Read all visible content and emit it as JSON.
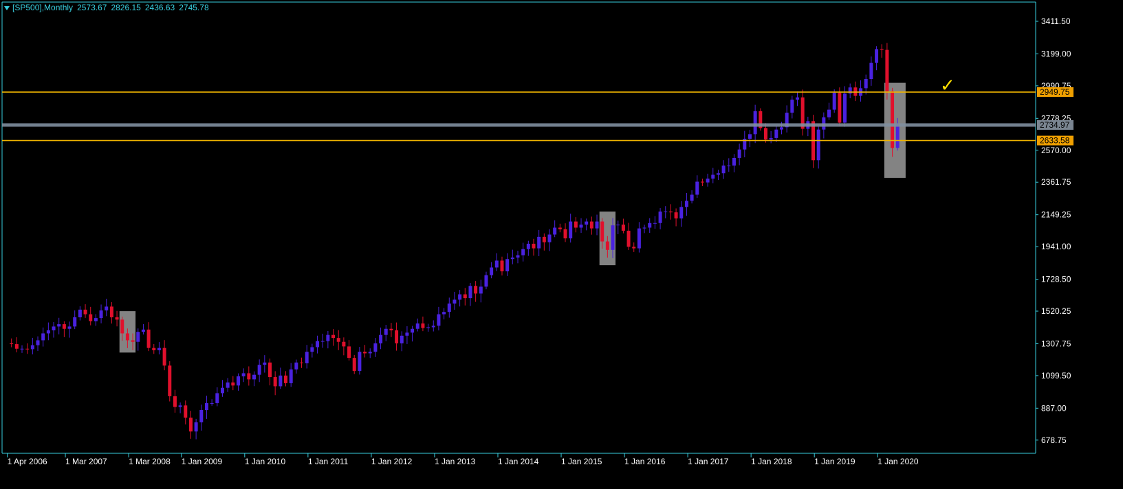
{
  "header": {
    "symbol": "[SP500],Monthly",
    "open": "2573.67",
    "high": "2826.15",
    "low": "2436.63",
    "close": "2745.78"
  },
  "colors": {
    "background": "#000000",
    "axis": "#39d0e0",
    "bull_candle": "#4a22e0",
    "bear_candle": "#e0102c",
    "level_line": "#f0b400",
    "price_line": "#8090a0",
    "zone": "#9a9a9a",
    "check": "#ffe000"
  },
  "icons": {
    "checkmark": "✓"
  },
  "chart_data": {
    "type": "candlestick",
    "timeframe": "Monthly",
    "ylim": [
      620,
      3480
    ],
    "y_ticks": [
      "3411.50",
      "3199.00",
      "2990.75",
      "2778.25",
      "2570.00",
      "2361.75",
      "2149.25",
      "1941.00",
      "1728.50",
      "1520.25",
      "1307.75",
      "1099.50",
      "887.00",
      "678.75"
    ],
    "x_tick_labels": [
      "1 Apr 2006",
      "1 Mar 2007",
      "1 Mar 2008",
      "1 Jan 2009",
      "1 Jan 2010",
      "1 Jan 2011",
      "1 Jan 2012",
      "1 Jan 2013",
      "1 Jan 2014",
      "1 Jan 2015",
      "1 Jan 2016",
      "1 Jan 2017",
      "1 Jan 2018",
      "1 Jan 2019",
      "1 Jan 2020"
    ],
    "levels": [
      {
        "label": "2949.75",
        "value": 2949.75,
        "kind": "resistance"
      },
      {
        "label": "2734.97",
        "value": 2734.97,
        "kind": "current"
      },
      {
        "label": "2633.58",
        "value": 2633.58,
        "kind": "support"
      }
    ],
    "zones": [
      {
        "from": "2008-01",
        "to": "2008-03",
        "low": 1250,
        "high": 1520
      },
      {
        "from": "2015-08",
        "to": "2015-10",
        "low": 1820,
        "high": 2170
      },
      {
        "from": "2020-02",
        "to": "2020-05",
        "low": 2390,
        "high": 3010
      }
    ],
    "close_series": [
      [
        "2006-03",
        1310
      ],
      [
        "2006-04",
        1305
      ],
      [
        "2006-05",
        1275
      ],
      [
        "2006-06",
        1275
      ],
      [
        "2006-07",
        1272
      ],
      [
        "2006-08",
        1298
      ],
      [
        "2006-09",
        1330
      ],
      [
        "2006-10",
        1375
      ],
      [
        "2006-11",
        1395
      ],
      [
        "2006-12",
        1420
      ],
      [
        "2007-01",
        1435
      ],
      [
        "2007-02",
        1405
      ],
      [
        "2007-03",
        1420
      ],
      [
        "2007-04",
        1480
      ],
      [
        "2007-05",
        1530
      ],
      [
        "2007-06",
        1500
      ],
      [
        "2007-07",
        1455
      ],
      [
        "2007-08",
        1475
      ],
      [
        "2007-09",
        1525
      ],
      [
        "2007-10",
        1550
      ],
      [
        "2007-11",
        1480
      ],
      [
        "2007-12",
        1465
      ],
      [
        "2008-01",
        1375
      ],
      [
        "2008-02",
        1330
      ],
      [
        "2008-03",
        1320
      ],
      [
        "2008-04",
        1385
      ],
      [
        "2008-05",
        1400
      ],
      [
        "2008-06",
        1280
      ],
      [
        "2008-07",
        1265
      ],
      [
        "2008-08",
        1280
      ],
      [
        "2008-09",
        1165
      ],
      [
        "2008-10",
        965
      ],
      [
        "2008-11",
        895
      ],
      [
        "2008-12",
        905
      ],
      [
        "2009-01",
        825
      ],
      [
        "2009-02",
        735
      ],
      [
        "2009-03",
        795
      ],
      [
        "2009-04",
        875
      ],
      [
        "2009-05",
        920
      ],
      [
        "2009-06",
        920
      ],
      [
        "2009-07",
        985
      ],
      [
        "2009-08",
        1020
      ],
      [
        "2009-09",
        1055
      ],
      [
        "2009-10",
        1035
      ],
      [
        "2009-11",
        1095
      ],
      [
        "2009-12",
        1115
      ],
      [
        "2010-01",
        1075
      ],
      [
        "2010-02",
        1105
      ],
      [
        "2010-03",
        1170
      ],
      [
        "2010-04",
        1185
      ],
      [
        "2010-05",
        1090
      ],
      [
        "2010-06",
        1030
      ],
      [
        "2010-07",
        1100
      ],
      [
        "2010-08",
        1050
      ],
      [
        "2010-09",
        1140
      ],
      [
        "2010-10",
        1185
      ],
      [
        "2010-11",
        1180
      ],
      [
        "2010-12",
        1255
      ],
      [
        "2011-01",
        1285
      ],
      [
        "2011-02",
        1325
      ],
      [
        "2011-03",
        1325
      ],
      [
        "2011-04",
        1365
      ],
      [
        "2011-05",
        1345
      ],
      [
        "2011-06",
        1320
      ],
      [
        "2011-07",
        1290
      ],
      [
        "2011-08",
        1215
      ],
      [
        "2011-09",
        1130
      ],
      [
        "2011-10",
        1255
      ],
      [
        "2011-11",
        1245
      ],
      [
        "2011-12",
        1255
      ],
      [
        "2012-01",
        1310
      ],
      [
        "2012-02",
        1365
      ],
      [
        "2012-03",
        1405
      ],
      [
        "2012-04",
        1395
      ],
      [
        "2012-05",
        1310
      ],
      [
        "2012-06",
        1360
      ],
      [
        "2012-07",
        1380
      ],
      [
        "2012-08",
        1405
      ],
      [
        "2012-09",
        1440
      ],
      [
        "2012-10",
        1410
      ],
      [
        "2012-11",
        1415
      ],
      [
        "2012-12",
        1425
      ],
      [
        "2013-01",
        1500
      ],
      [
        "2013-02",
        1515
      ],
      [
        "2013-03",
        1570
      ],
      [
        "2013-04",
        1595
      ],
      [
        "2013-05",
        1630
      ],
      [
        "2013-06",
        1605
      ],
      [
        "2013-07",
        1685
      ],
      [
        "2013-08",
        1635
      ],
      [
        "2013-09",
        1680
      ],
      [
        "2013-10",
        1755
      ],
      [
        "2013-11",
        1805
      ],
      [
        "2013-12",
        1850
      ],
      [
        "2014-01",
        1780
      ],
      [
        "2014-02",
        1860
      ],
      [
        "2014-03",
        1870
      ],
      [
        "2014-04",
        1885
      ],
      [
        "2014-05",
        1925
      ],
      [
        "2014-06",
        1960
      ],
      [
        "2014-07",
        1930
      ],
      [
        "2014-08",
        2005
      ],
      [
        "2014-09",
        1970
      ],
      [
        "2014-10",
        2020
      ],
      [
        "2014-11",
        2065
      ],
      [
        "2014-12",
        2055
      ],
      [
        "2015-01",
        1995
      ],
      [
        "2015-02",
        2105
      ],
      [
        "2015-03",
        2065
      ],
      [
        "2015-04",
        2085
      ],
      [
        "2015-05",
        2105
      ],
      [
        "2015-06",
        2060
      ],
      [
        "2015-07",
        2105
      ],
      [
        "2015-08",
        1975
      ],
      [
        "2015-09",
        1920
      ],
      [
        "2015-10",
        2080
      ],
      [
        "2015-11",
        2085
      ],
      [
        "2015-12",
        2045
      ],
      [
        "2016-01",
        1940
      ],
      [
        "2016-02",
        1930
      ],
      [
        "2016-03",
        2060
      ],
      [
        "2016-04",
        2065
      ],
      [
        "2016-05",
        2095
      ],
      [
        "2016-06",
        2095
      ],
      [
        "2016-07",
        2170
      ],
      [
        "2016-08",
        2170
      ],
      [
        "2016-09",
        2165
      ],
      [
        "2016-10",
        2125
      ],
      [
        "2016-11",
        2200
      ],
      [
        "2016-12",
        2240
      ],
      [
        "2017-01",
        2280
      ],
      [
        "2017-02",
        2365
      ],
      [
        "2017-03",
        2360
      ],
      [
        "2017-04",
        2385
      ],
      [
        "2017-05",
        2410
      ],
      [
        "2017-06",
        2420
      ],
      [
        "2017-07",
        2470
      ],
      [
        "2017-08",
        2470
      ],
      [
        "2017-09",
        2520
      ],
      [
        "2017-10",
        2575
      ],
      [
        "2017-11",
        2645
      ],
      [
        "2017-12",
        2675
      ],
      [
        "2018-01",
        2825
      ],
      [
        "2018-02",
        2715
      ],
      [
        "2018-03",
        2640
      ],
      [
        "2018-04",
        2650
      ],
      [
        "2018-05",
        2705
      ],
      [
        "2018-06",
        2720
      ],
      [
        "2018-07",
        2815
      ],
      [
        "2018-08",
        2900
      ],
      [
        "2018-09",
        2915
      ],
      [
        "2018-10",
        2710
      ],
      [
        "2018-11",
        2760
      ],
      [
        "2018-12",
        2505
      ],
      [
        "2019-01",
        2705
      ],
      [
        "2019-02",
        2785
      ],
      [
        "2019-03",
        2835
      ],
      [
        "2019-04",
        2945
      ],
      [
        "2019-05",
        2750
      ],
      [
        "2019-06",
        2940
      ],
      [
        "2019-07",
        2980
      ],
      [
        "2019-08",
        2925
      ],
      [
        "2019-09",
        2975
      ],
      [
        "2019-10",
        3035
      ],
      [
        "2019-11",
        3140
      ],
      [
        "2019-12",
        3230
      ],
      [
        "2020-01",
        3225
      ],
      [
        "2020-02",
        2955
      ],
      [
        "2020-03",
        2585
      ],
      [
        "2020-04",
        2745
      ]
    ]
  }
}
